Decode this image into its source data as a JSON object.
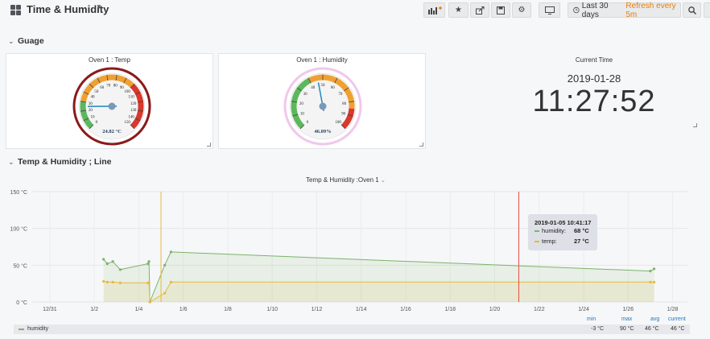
{
  "header": {
    "title": "Time & Humidity",
    "time_range": "Last 30 days",
    "refresh": "Refresh every 5m"
  },
  "rows": [
    {
      "title": "Guage"
    },
    {
      "title": "Temp & Humidity ; Line"
    }
  ],
  "gauges": [
    {
      "title": "Oven 1 : Temp",
      "value_text": "24.82 °C",
      "value": 24.82,
      "min": 0,
      "max": 150,
      "ticks": [
        "0",
        "10",
        "20",
        "30",
        "40",
        "50",
        "60",
        "70",
        "80",
        "90",
        "100",
        "110",
        "120",
        "130",
        "140",
        "150"
      ]
    },
    {
      "title": "Oven 1 : Humidity",
      "value_text": "46.09%",
      "value": 46.09,
      "min": 0,
      "max": 100,
      "ticks": [
        "0",
        "10",
        "20",
        "30",
        "40",
        "50",
        "60",
        "70",
        "80",
        "90",
        "100"
      ]
    }
  ],
  "clock": {
    "title": "Current Time",
    "date": "2019-01-28",
    "time": "11:27:52"
  },
  "graph": {
    "title": "Temp & Humidity :Oven 1",
    "tooltip": {
      "time": "2019-01-05 10:41:17",
      "humidity_label": "humidity:",
      "humidity_value": "68 °C",
      "temp_label": "temp:",
      "temp_value": "27 °C"
    },
    "legend": {
      "headers": [
        "min",
        "max",
        "avg",
        "current"
      ],
      "series": [
        {
          "name": "humidity",
          "min": "-3 °C",
          "max": "90 °C",
          "avg": "46 °C",
          "current": "46 °C"
        }
      ]
    }
  },
  "chart_data": {
    "type": "line",
    "title": "Temp & Humidity :Oven 1",
    "ylim": [
      0,
      150
    ],
    "yticks": [
      "0 °C",
      "50 °C",
      "100 °C",
      "150 °C"
    ],
    "xticks": [
      "12/31",
      "1/2",
      "1/4",
      "1/6",
      "1/8",
      "1/10",
      "1/12",
      "1/14",
      "1/16",
      "1/18",
      "1/20",
      "1/22",
      "1/24",
      "1/26",
      "1/28"
    ],
    "series": [
      {
        "name": "humidity",
        "color": "#7eb26d",
        "points": [
          [
            "2019-01-02 10:00",
            58
          ],
          [
            "2019-01-02 14:00",
            52
          ],
          [
            "2019-01-02 20:00",
            55
          ],
          [
            "2019-01-03 04:00",
            44
          ],
          [
            "2019-01-04 10:00",
            52
          ],
          [
            "2019-01-04 11:00",
            55
          ],
          [
            "2019-01-04 12:00",
            0
          ],
          [
            "2019-01-05 04:00",
            50
          ],
          [
            "2019-01-05 10:41",
            68
          ],
          [
            "2019-01-27 00:00",
            42
          ],
          [
            "2019-01-27 04:00",
            45
          ]
        ]
      },
      {
        "name": "temp",
        "color": "#eab839",
        "points": [
          [
            "2019-01-02 10:00",
            28
          ],
          [
            "2019-01-02 14:00",
            27
          ],
          [
            "2019-01-02 20:00",
            27
          ],
          [
            "2019-01-03 04:00",
            26
          ],
          [
            "2019-01-04 10:00",
            26
          ],
          [
            "2019-01-04 11:00",
            26
          ],
          [
            "2019-01-04 12:00",
            0
          ],
          [
            "2019-01-05 04:00",
            12
          ],
          [
            "2019-01-05 10:41",
            27
          ],
          [
            "2019-01-27 00:00",
            27
          ],
          [
            "2019-01-27 04:00",
            27
          ]
        ]
      }
    ]
  },
  "colors": {
    "humidity": "#7eb26d",
    "temp": "#eab839",
    "cursor": "#e24d42",
    "gauge_green": "#5cb85c",
    "gauge_orange": "#f0a030",
    "gauge_red": "#d9382d"
  },
  "icons": [
    "grid-icon",
    "add-panel-icon",
    "star-icon",
    "share-icon",
    "save-icon",
    "gear-icon",
    "monitor-icon",
    "clock-icon",
    "search-icon"
  ]
}
